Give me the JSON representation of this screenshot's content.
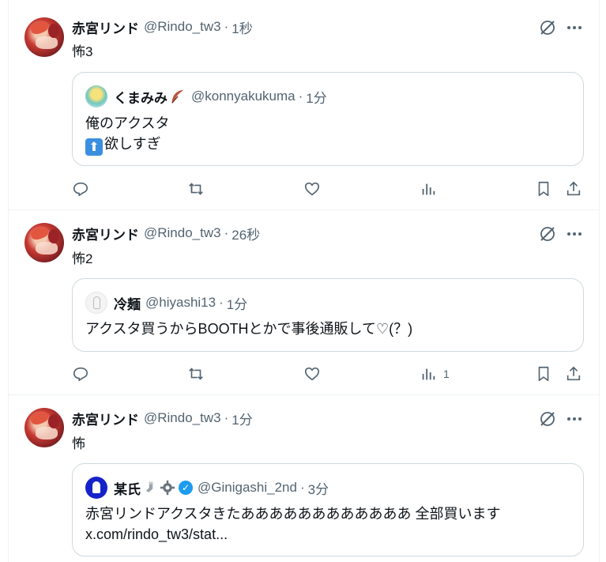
{
  "posts": [
    {
      "name": "赤宮リンド",
      "handle": "@Rindo_tw3",
      "dot": "·",
      "time": "1秒",
      "text": "怖3",
      "quote": {
        "name": "くまみみ",
        "name_emoji": "feather-icon",
        "handle": "@konnyakukuma",
        "dot": "·",
        "time": "1分",
        "lines": [
          "俺のアクスタ",
          "欲しすぎ"
        ],
        "line2_emoji": "up-arrow-emoji"
      },
      "actions": {
        "reply": "",
        "repost": "",
        "like": "",
        "views": "",
        "bookmark": "",
        "share": ""
      }
    },
    {
      "name": "赤宮リンド",
      "handle": "@Rindo_tw3",
      "dot": "·",
      "time": "26秒",
      "text": "怖2",
      "quote": {
        "name": "冷麺",
        "handle": "@hiyashi13",
        "dot": "·",
        "time": "1分",
        "lines": [
          "アクスタ買うからBOOTHとかで事後通販して♡(？)"
        ]
      },
      "actions": {
        "reply": "",
        "repost": "",
        "like": "",
        "views": "1",
        "bookmark": "",
        "share": ""
      }
    },
    {
      "name": "赤宮リンド",
      "handle": "@Rindo_tw3",
      "dot": "·",
      "time": "1分",
      "text": "怖",
      "quote": {
        "name": "某氏",
        "handle": "@Ginigashi_2nd",
        "dot": "·",
        "time": "3分",
        "verified": true,
        "lines": [
          "赤宮リンドアクスタきたああああああああああああ 全部買います",
          "x.com/rindo_tw3/stat..."
        ]
      }
    }
  ],
  "colors": {
    "text": "#0f1419",
    "muted": "#536471",
    "border": "#cfd9de",
    "divider": "#eff3f4",
    "verified": "#1d9bf0"
  },
  "icons": [
    "grok-icon",
    "more-icon",
    "reply-icon",
    "repost-icon",
    "like-icon",
    "views-icon",
    "bookmark-icon",
    "share-icon"
  ]
}
